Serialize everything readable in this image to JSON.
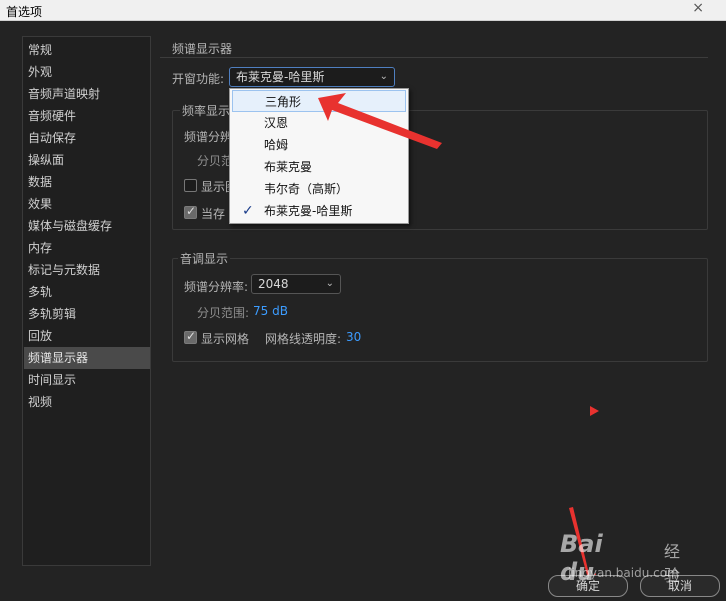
{
  "window": {
    "title": "首选项",
    "close_glyph": "×"
  },
  "sidebar": {
    "items": [
      {
        "label": "常规"
      },
      {
        "label": "外观"
      },
      {
        "label": "音频声道映射"
      },
      {
        "label": "音频硬件"
      },
      {
        "label": "自动保存"
      },
      {
        "label": "操纵面"
      },
      {
        "label": "数据"
      },
      {
        "label": "效果"
      },
      {
        "label": "媒体与磁盘缓存"
      },
      {
        "label": "内存"
      },
      {
        "label": "标记与元数据"
      },
      {
        "label": "多轨"
      },
      {
        "label": "多轨剪辑"
      },
      {
        "label": "回放"
      },
      {
        "label": "频谱显示器",
        "selected": true
      },
      {
        "label": "时间显示"
      },
      {
        "label": "视频"
      }
    ]
  },
  "main": {
    "heading": "频谱显示器",
    "window_function_label": "开窗功能:",
    "window_function_value": "布莱克曼-哈里斯",
    "freq_group": {
      "title_partial": "频率显示",
      "resolution_label_partial": "频谱分辨",
      "db_range_label_partial": "分贝范",
      "show_grid_partial": "显示图",
      "current_partial": "当存"
    },
    "pitch_group": {
      "title": "音调显示",
      "resolution_label": "频谱分辨率:",
      "resolution_value": "2048",
      "db_range_label": "分贝范围:",
      "db_range_value": "75 dB",
      "show_grid_label": "显示网格",
      "grid_opacity_label": "网格线透明度:",
      "grid_opacity_value": "30"
    }
  },
  "dropdown": {
    "options": [
      {
        "label": "三角形",
        "hover": true
      },
      {
        "label": "汉恩"
      },
      {
        "label": "哈姆"
      },
      {
        "label": "布莱克曼"
      },
      {
        "label": "韦尔奇（高斯）"
      },
      {
        "label": "布莱克曼-哈里斯",
        "checked": true
      }
    ]
  },
  "buttons": {
    "ok": "确定",
    "cancel": "取消"
  },
  "watermark": {
    "brand": "Bai du",
    "sub": "经验",
    "url": "jingyan.baidu.com"
  },
  "colors": {
    "accent_blue": "#3c9cff",
    "annotation_red": "#e8322f"
  }
}
